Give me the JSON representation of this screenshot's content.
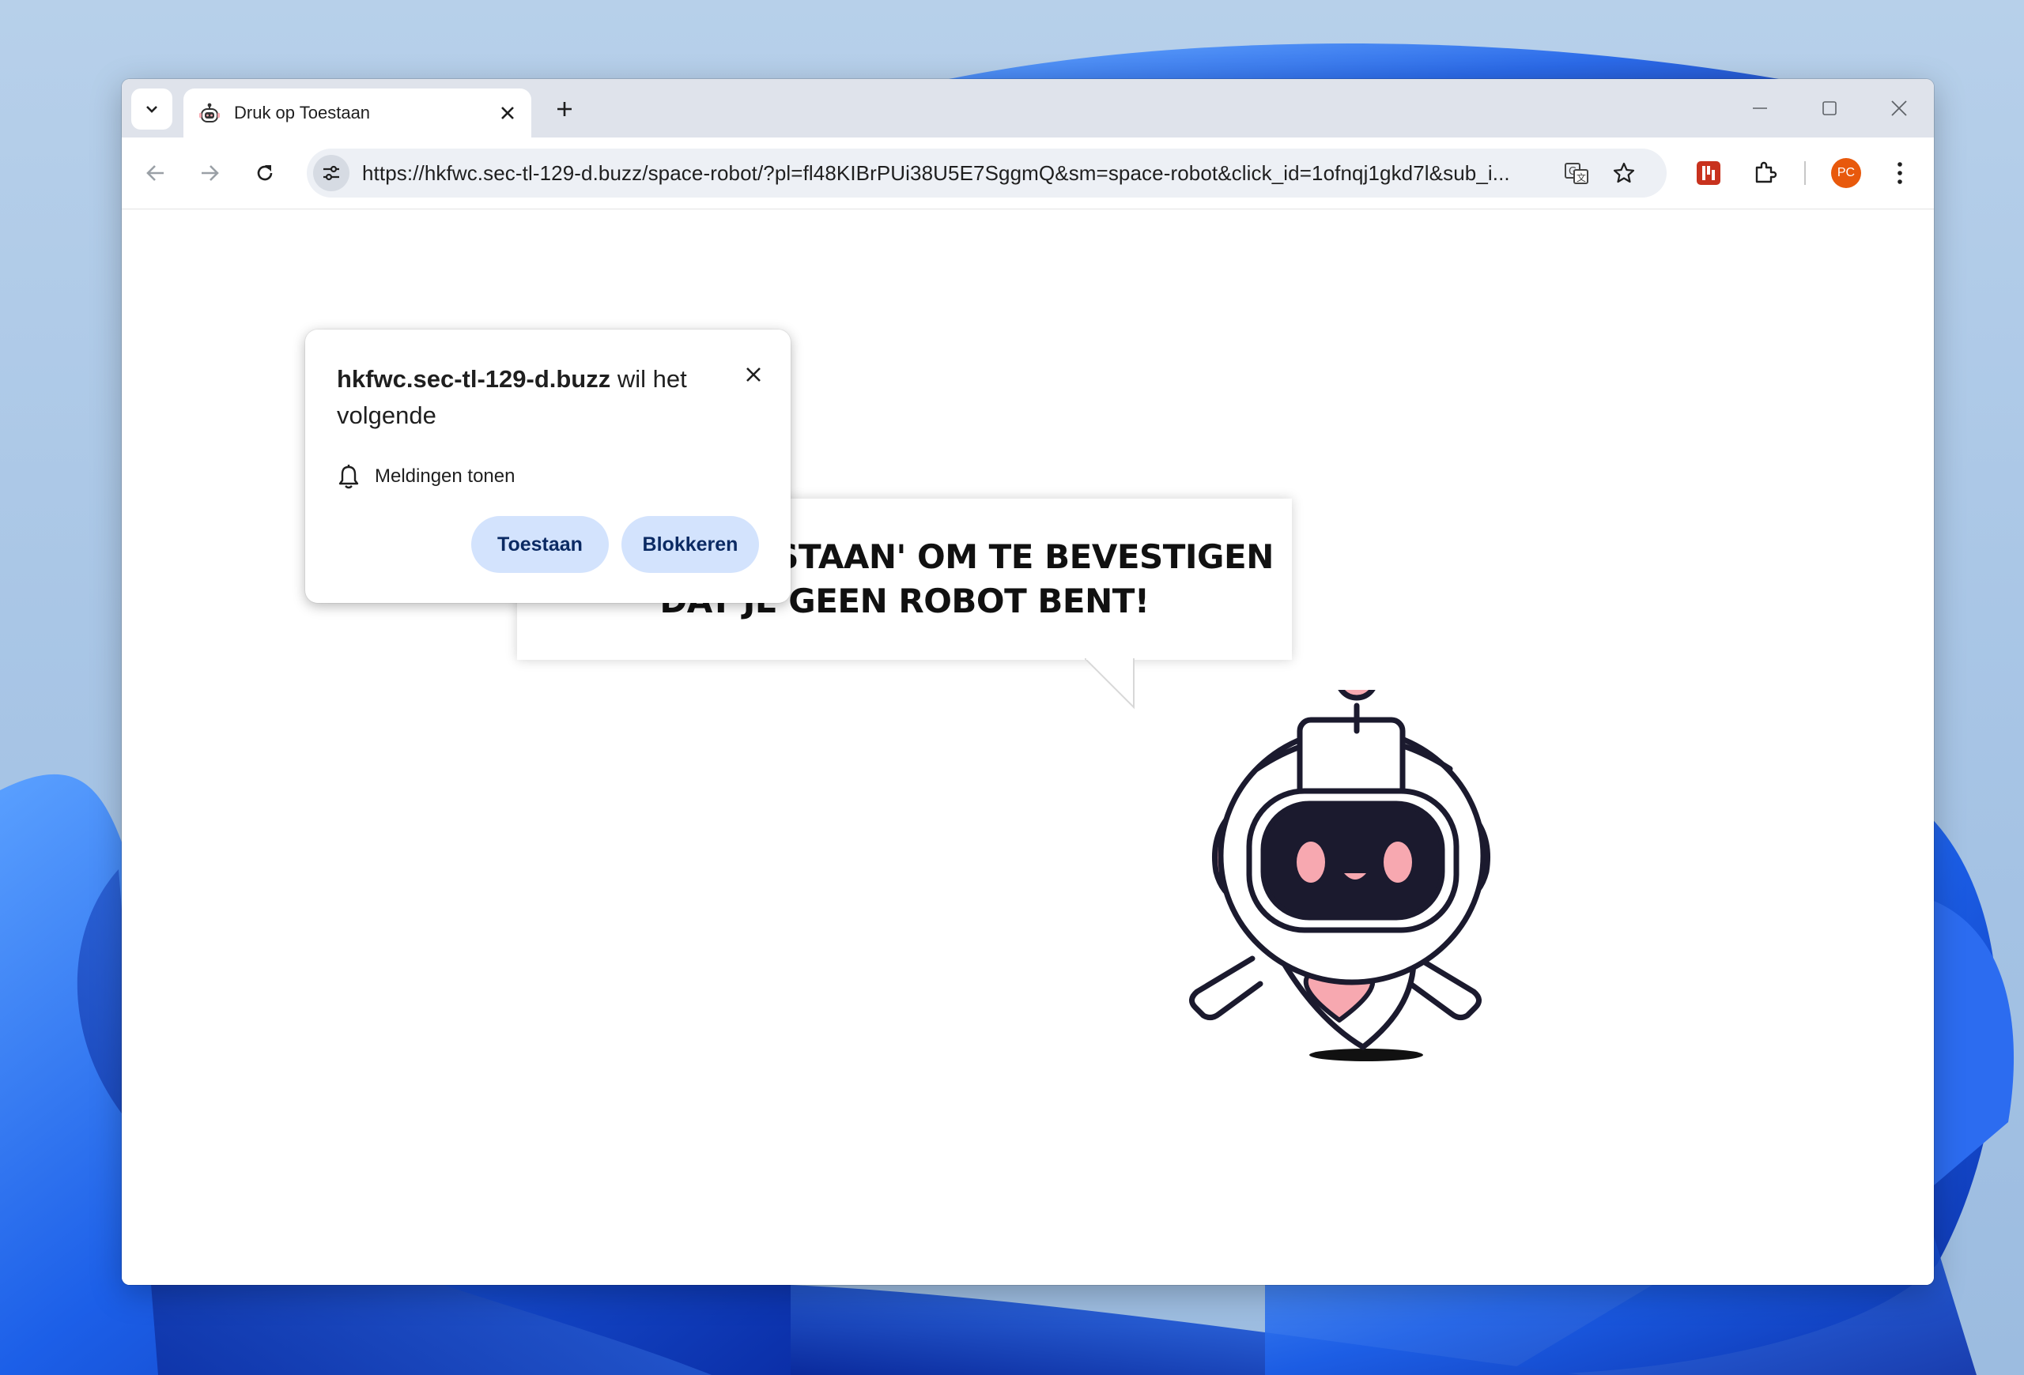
{
  "tab": {
    "title": "Druk op Toestaan",
    "favicon": "robot-icon"
  },
  "omnibox": {
    "url": "https://hkfwc.sec-tl-129-d.buzz/space-robot/?pl=fl48KIBrPUi38U5E7SggmQ&sm=space-robot&click_id=1ofnqj1gkd7l&sub_i..."
  },
  "profile": {
    "initials": "PC",
    "color": "#e8590c"
  },
  "permission_popup": {
    "site": "hkfwc.sec-tl-129-d.buzz",
    "wants_text": " wil het volgende",
    "permission": "Meldingen tonen",
    "allow_label": "Toestaan",
    "block_label": "Blokkeren"
  },
  "page": {
    "headline_line1": "KLIK OP 'TOESTAAN' OM TE BEVESTIGEN",
    "headline_line2": "DAT JE GEEN ROBOT BENT!"
  },
  "colors": {
    "accent_button": "#d3e3fd",
    "robot_pink": "#f7a8b0",
    "robot_outline": "#1b1a2e",
    "windows_blue": "#1e5ee6"
  }
}
